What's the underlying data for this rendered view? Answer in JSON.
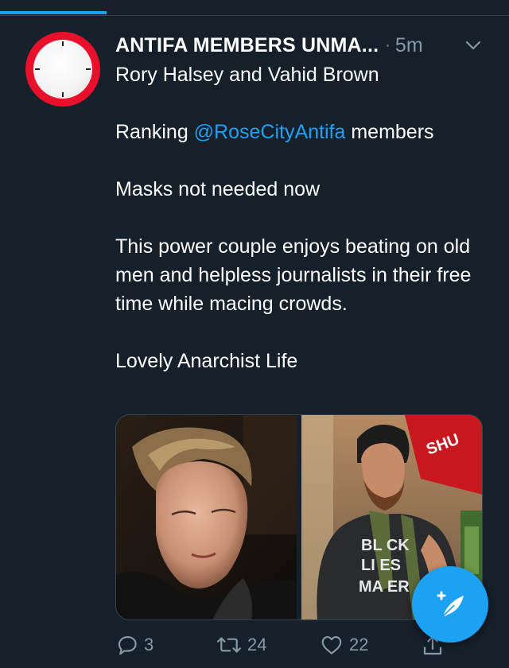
{
  "progress": {
    "fraction": 0.21
  },
  "tweet": {
    "author_name": "ANTIFA MEMBERS UNMA...",
    "separator": "·",
    "time": "5m",
    "avatar_icon": "clock-face-avatar",
    "menu_icon": "chevron-down-icon",
    "lines": {
      "line1": "Rory Halsey and Vahid Brown",
      "line2_before": "Ranking ",
      "line2_mention": "@RoseCityAntifa",
      "line2_after": " members",
      "line3": "Masks not needed now",
      "line4": "This power couple enjoys beating on old men and helpless journalists in their free time while macing crowds.",
      "line5": "Lovely Anarchist Life"
    },
    "media": [
      {
        "description_icon": "photo-woman-eyes-closed"
      },
      {
        "description_icon": "photo-bearded-man-black-lives-matter-shirt",
        "shirt_text": "BLACK LIVES MATTER"
      }
    ],
    "actions": {
      "reply": {
        "icon": "reply-icon",
        "count": "3"
      },
      "retweet": {
        "icon": "retweet-icon",
        "count": "24"
      },
      "like": {
        "icon": "heart-icon",
        "count": "22"
      },
      "share": {
        "icon": "share-icon"
      }
    }
  },
  "compose_button": {
    "icon": "compose-feather-icon"
  },
  "colors": {
    "background": "#15202b",
    "accent": "#1da1f2",
    "muted": "#8899a6",
    "divider": "#38444d"
  }
}
